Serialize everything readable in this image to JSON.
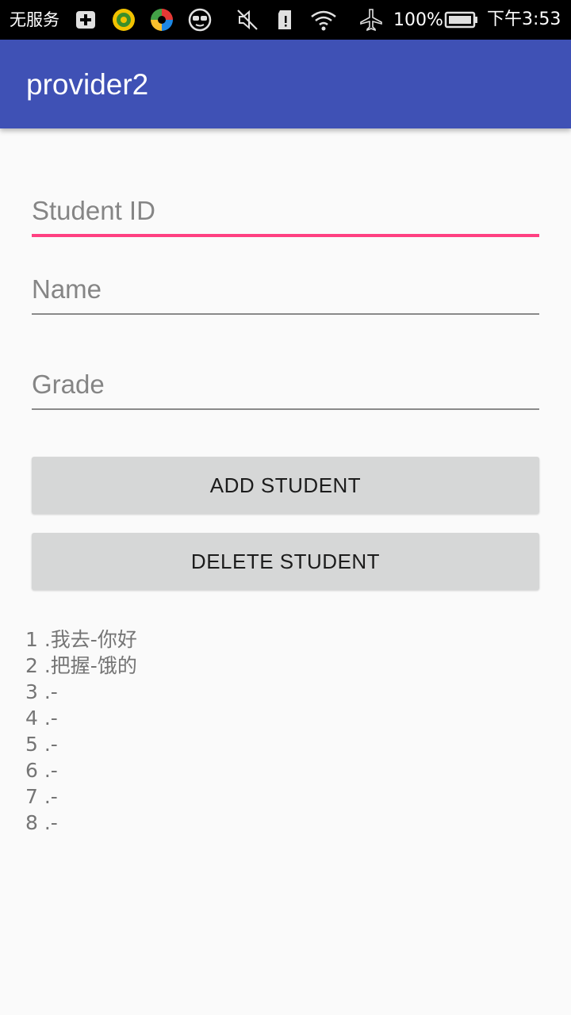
{
  "status_bar": {
    "carrier": "无服务",
    "battery_percent": "100%",
    "time": "下午3:53",
    "icons": [
      "plus-box-icon",
      "yellow-app-icon",
      "colorful-app-icon",
      "glasses-face-icon",
      "mute-icon",
      "sd-card-icon",
      "wifi-icon",
      "airplane-icon",
      "battery-icon"
    ]
  },
  "app_bar": {
    "title": "provider2"
  },
  "form": {
    "student_id_placeholder": "Student ID",
    "name_placeholder": "Name",
    "grade_placeholder": "Grade",
    "add_button_label": "ADD STUDENT",
    "delete_button_label": "DELETE STUDENT"
  },
  "students": [
    "1 .我去-你好",
    "2 .把握-饿的",
    "3 .-",
    "4 .-",
    "5 .-",
    "6 .-",
    "7 .-",
    "8 .-"
  ],
  "colors": {
    "primary": "#3f51b5",
    "accent": "#ff4081",
    "button": "#d6d7d7",
    "background": "#fafafa"
  }
}
